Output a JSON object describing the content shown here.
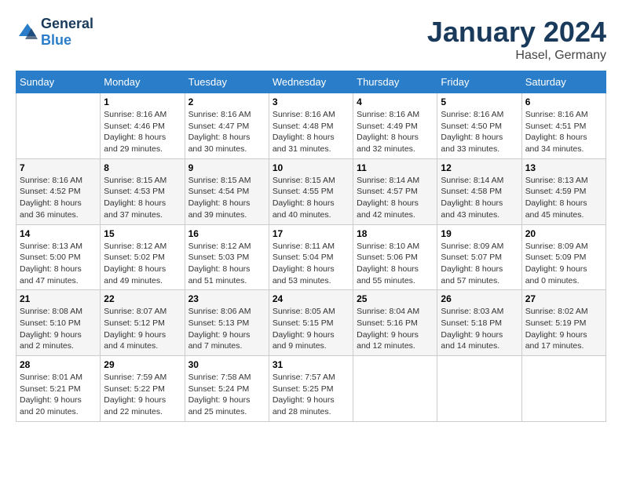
{
  "logo": {
    "general": "General",
    "blue": "Blue"
  },
  "title": "January 2024",
  "location": "Hasel, Germany",
  "days_of_week": [
    "Sunday",
    "Monday",
    "Tuesday",
    "Wednesday",
    "Thursday",
    "Friday",
    "Saturday"
  ],
  "weeks": [
    [
      {
        "day": "",
        "sunrise": "",
        "sunset": "",
        "daylight": ""
      },
      {
        "day": "1",
        "sunrise": "Sunrise: 8:16 AM",
        "sunset": "Sunset: 4:46 PM",
        "daylight": "Daylight: 8 hours and 29 minutes."
      },
      {
        "day": "2",
        "sunrise": "Sunrise: 8:16 AM",
        "sunset": "Sunset: 4:47 PM",
        "daylight": "Daylight: 8 hours and 30 minutes."
      },
      {
        "day": "3",
        "sunrise": "Sunrise: 8:16 AM",
        "sunset": "Sunset: 4:48 PM",
        "daylight": "Daylight: 8 hours and 31 minutes."
      },
      {
        "day": "4",
        "sunrise": "Sunrise: 8:16 AM",
        "sunset": "Sunset: 4:49 PM",
        "daylight": "Daylight: 8 hours and 32 minutes."
      },
      {
        "day": "5",
        "sunrise": "Sunrise: 8:16 AM",
        "sunset": "Sunset: 4:50 PM",
        "daylight": "Daylight: 8 hours and 33 minutes."
      },
      {
        "day": "6",
        "sunrise": "Sunrise: 8:16 AM",
        "sunset": "Sunset: 4:51 PM",
        "daylight": "Daylight: 8 hours and 34 minutes."
      }
    ],
    [
      {
        "day": "7",
        "sunrise": "Sunrise: 8:16 AM",
        "sunset": "Sunset: 4:52 PM",
        "daylight": "Daylight: 8 hours and 36 minutes."
      },
      {
        "day": "8",
        "sunrise": "Sunrise: 8:15 AM",
        "sunset": "Sunset: 4:53 PM",
        "daylight": "Daylight: 8 hours and 37 minutes."
      },
      {
        "day": "9",
        "sunrise": "Sunrise: 8:15 AM",
        "sunset": "Sunset: 4:54 PM",
        "daylight": "Daylight: 8 hours and 39 minutes."
      },
      {
        "day": "10",
        "sunrise": "Sunrise: 8:15 AM",
        "sunset": "Sunset: 4:55 PM",
        "daylight": "Daylight: 8 hours and 40 minutes."
      },
      {
        "day": "11",
        "sunrise": "Sunrise: 8:14 AM",
        "sunset": "Sunset: 4:57 PM",
        "daylight": "Daylight: 8 hours and 42 minutes."
      },
      {
        "day": "12",
        "sunrise": "Sunrise: 8:14 AM",
        "sunset": "Sunset: 4:58 PM",
        "daylight": "Daylight: 8 hours and 43 minutes."
      },
      {
        "day": "13",
        "sunrise": "Sunrise: 8:13 AM",
        "sunset": "Sunset: 4:59 PM",
        "daylight": "Daylight: 8 hours and 45 minutes."
      }
    ],
    [
      {
        "day": "14",
        "sunrise": "Sunrise: 8:13 AM",
        "sunset": "Sunset: 5:00 PM",
        "daylight": "Daylight: 8 hours and 47 minutes."
      },
      {
        "day": "15",
        "sunrise": "Sunrise: 8:12 AM",
        "sunset": "Sunset: 5:02 PM",
        "daylight": "Daylight: 8 hours and 49 minutes."
      },
      {
        "day": "16",
        "sunrise": "Sunrise: 8:12 AM",
        "sunset": "Sunset: 5:03 PM",
        "daylight": "Daylight: 8 hours and 51 minutes."
      },
      {
        "day": "17",
        "sunrise": "Sunrise: 8:11 AM",
        "sunset": "Sunset: 5:04 PM",
        "daylight": "Daylight: 8 hours and 53 minutes."
      },
      {
        "day": "18",
        "sunrise": "Sunrise: 8:10 AM",
        "sunset": "Sunset: 5:06 PM",
        "daylight": "Daylight: 8 hours and 55 minutes."
      },
      {
        "day": "19",
        "sunrise": "Sunrise: 8:09 AM",
        "sunset": "Sunset: 5:07 PM",
        "daylight": "Daylight: 8 hours and 57 minutes."
      },
      {
        "day": "20",
        "sunrise": "Sunrise: 8:09 AM",
        "sunset": "Sunset: 5:09 PM",
        "daylight": "Daylight: 9 hours and 0 minutes."
      }
    ],
    [
      {
        "day": "21",
        "sunrise": "Sunrise: 8:08 AM",
        "sunset": "Sunset: 5:10 PM",
        "daylight": "Daylight: 9 hours and 2 minutes."
      },
      {
        "day": "22",
        "sunrise": "Sunrise: 8:07 AM",
        "sunset": "Sunset: 5:12 PM",
        "daylight": "Daylight: 9 hours and 4 minutes."
      },
      {
        "day": "23",
        "sunrise": "Sunrise: 8:06 AM",
        "sunset": "Sunset: 5:13 PM",
        "daylight": "Daylight: 9 hours and 7 minutes."
      },
      {
        "day": "24",
        "sunrise": "Sunrise: 8:05 AM",
        "sunset": "Sunset: 5:15 PM",
        "daylight": "Daylight: 9 hours and 9 minutes."
      },
      {
        "day": "25",
        "sunrise": "Sunrise: 8:04 AM",
        "sunset": "Sunset: 5:16 PM",
        "daylight": "Daylight: 9 hours and 12 minutes."
      },
      {
        "day": "26",
        "sunrise": "Sunrise: 8:03 AM",
        "sunset": "Sunset: 5:18 PM",
        "daylight": "Daylight: 9 hours and 14 minutes."
      },
      {
        "day": "27",
        "sunrise": "Sunrise: 8:02 AM",
        "sunset": "Sunset: 5:19 PM",
        "daylight": "Daylight: 9 hours and 17 minutes."
      }
    ],
    [
      {
        "day": "28",
        "sunrise": "Sunrise: 8:01 AM",
        "sunset": "Sunset: 5:21 PM",
        "daylight": "Daylight: 9 hours and 20 minutes."
      },
      {
        "day": "29",
        "sunrise": "Sunrise: 7:59 AM",
        "sunset": "Sunset: 5:22 PM",
        "daylight": "Daylight: 9 hours and 22 minutes."
      },
      {
        "day": "30",
        "sunrise": "Sunrise: 7:58 AM",
        "sunset": "Sunset: 5:24 PM",
        "daylight": "Daylight: 9 hours and 25 minutes."
      },
      {
        "day": "31",
        "sunrise": "Sunrise: 7:57 AM",
        "sunset": "Sunset: 5:25 PM",
        "daylight": "Daylight: 9 hours and 28 minutes."
      },
      {
        "day": "",
        "sunrise": "",
        "sunset": "",
        "daylight": ""
      },
      {
        "day": "",
        "sunrise": "",
        "sunset": "",
        "daylight": ""
      },
      {
        "day": "",
        "sunrise": "",
        "sunset": "",
        "daylight": ""
      }
    ]
  ]
}
